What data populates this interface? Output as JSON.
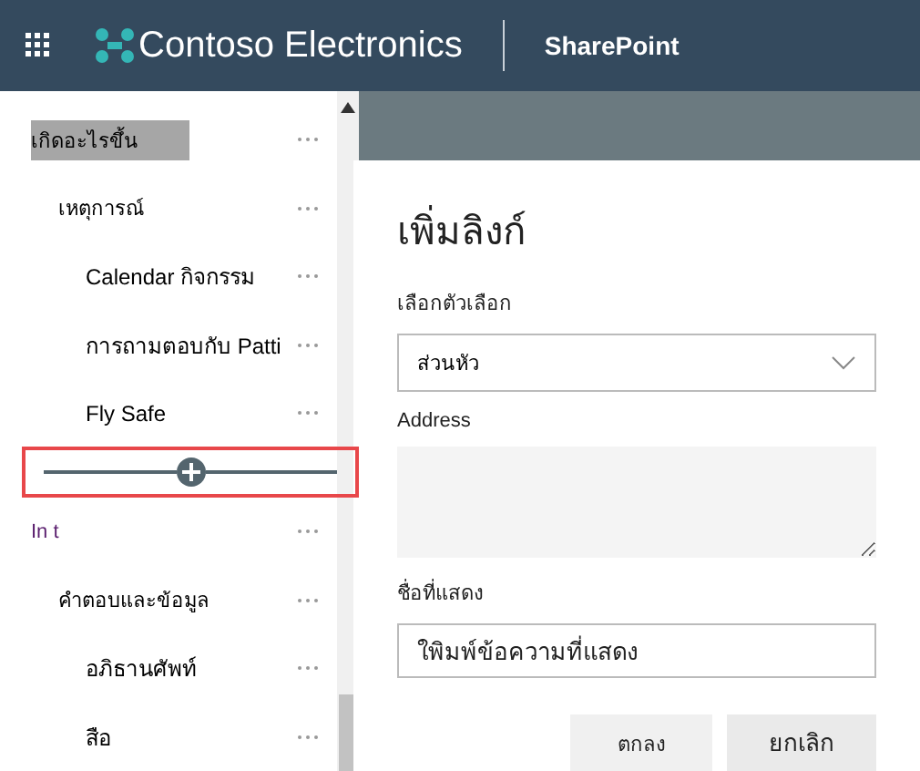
{
  "header": {
    "brand": "Contoso Electronics",
    "app": "SharePoint"
  },
  "nav": [
    {
      "kind": "link",
      "label": "เกิดอะไรขึ้น",
      "selected": true,
      "children": [
        {
          "kind": "link",
          "label": "เหตุการณ์",
          "selected": false,
          "children": [
            {
              "kind": "link",
              "label": "Calendar กิจกรรม",
              "selected": false
            },
            {
              "kind": "link",
              "label": "การถามตอบกับ Patti",
              "selected": false
            },
            {
              "kind": "link",
              "label": "Fly Safe",
              "selected": false
            }
          ]
        }
      ]
    },
    {
      "kind": "insert_line"
    },
    {
      "kind": "link",
      "label": "In t",
      "selected": false,
      "children": [
        {
          "kind": "link",
          "label": "คำตอบและข้อมูล",
          "selected": false,
          "children": [
            {
              "kind": "link",
              "label": "อภิธานศัพท์",
              "selected": false
            },
            {
              "kind": "link",
              "label": "สือ",
              "selected": false
            }
          ]
        }
      ]
    }
  ],
  "dialog": {
    "title": "เพิ่มลิงก์",
    "choice_label": "เลือกตัวเลือก",
    "choice_value": "ส่วนหัว",
    "address_label": "Address",
    "display_label": "ชื่อที่แสดง",
    "display_placeholder": "ใพิมพ์ข้อความที่แสดง",
    "buttons": [
      "ตกลง",
      "ยกเลิก"
    ]
  }
}
